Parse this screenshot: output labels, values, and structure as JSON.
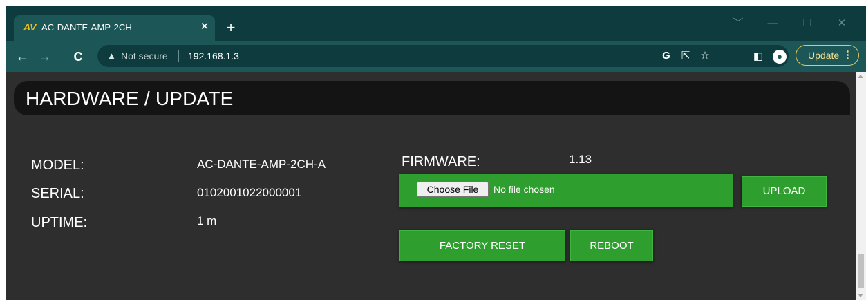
{
  "browser": {
    "tab": {
      "title": "AC-DANTE-AMP-2CH",
      "logo": "AV"
    },
    "security_label": "Not secure",
    "url": "192.168.1.3",
    "update_label": "Update",
    "icons": [
      "back-icon",
      "forward-icon",
      "reload-icon",
      "warning-icon",
      "google-icon",
      "share-icon",
      "star-icon",
      "sidepanel-icon",
      "profile-icon",
      "menu-icon"
    ]
  },
  "page": {
    "title": "HARDWARE / UPDATE",
    "model": {
      "label": "MODEL:",
      "value": "AC-DANTE-AMP-2CH-A"
    },
    "serial": {
      "label": "SERIAL:",
      "value": "0102001022000001"
    },
    "uptime": {
      "label": "UPTIME:",
      "value": "1 m"
    },
    "firmware": {
      "label": "FIRMWARE:",
      "value": "1.13"
    },
    "file_input": {
      "button": "Choose File",
      "status": "No file chosen"
    },
    "buttons": {
      "upload": "UPLOAD",
      "factory_reset": "FACTORY RESET",
      "reboot": "REBOOT"
    }
  },
  "colors": {
    "accent_green": "#2e9e2e",
    "page_bg": "#2e2e2e",
    "header_bg": "#141414",
    "chrome_dark": "#0d3b3e",
    "chrome_light": "#1c5656"
  }
}
